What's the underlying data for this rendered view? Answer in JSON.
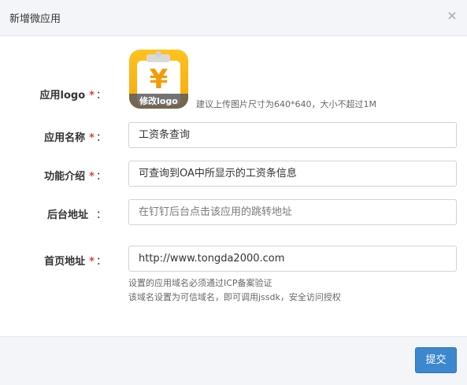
{
  "dialog": {
    "title": "新增微应用",
    "close_icon": "×"
  },
  "form": {
    "required_mark": "*",
    "colon": "：",
    "logo": {
      "label": "应用logo",
      "icon": "yen-clipboard-icon",
      "icon_glyph": "¥",
      "overlay_text": "修改logo",
      "hint": "建议上传图片尺寸为640*640，大小不超过1M"
    },
    "app_name": {
      "label": "应用名称",
      "value": "工资条查询"
    },
    "intro": {
      "label": "功能介绍",
      "value": "可查询到OA中所显示的工资条信息"
    },
    "backend_url": {
      "label": "后台地址",
      "placeholder": "在钉钉后台点击该应用的跳转地址"
    },
    "home_url": {
      "label": "首页地址",
      "value": "http://www.tongda2000.com",
      "hint_line1": "设置的应用域名必须通过ICP备案验证",
      "hint_line2": "该域名设置为可信域名，即可调用jssdk，安全访问授权"
    }
  },
  "footer": {
    "submit_label": "提交"
  },
  "colors": {
    "primary": "#3d87cf",
    "required": "#e03b3b",
    "logo_bg": "#ffc21d"
  }
}
